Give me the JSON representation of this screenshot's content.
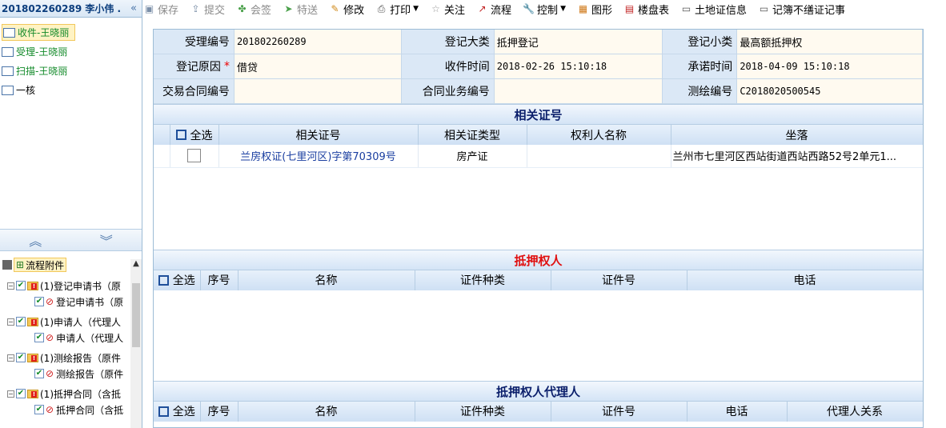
{
  "left": {
    "title": "201802260289 李小伟 ...",
    "collapse_glyph": "«",
    "steps": [
      {
        "label": "收件-王晓丽",
        "style": "active green"
      },
      {
        "label": "受理-王晓丽",
        "style": "green"
      },
      {
        "label": "扫描-王晓丽",
        "style": "green"
      },
      {
        "label": "一核",
        "style": ""
      }
    ],
    "splitter": {
      "up_glyph": "︽",
      "down_glyph": "︾"
    },
    "tree": {
      "root_label": "流程附件",
      "items": [
        {
          "parent": "(1)登记申请书（原",
          "child": "登记申请书（原"
        },
        {
          "parent": "(1)申请人（代理人",
          "child": "申请人（代理人"
        },
        {
          "parent": "(1)测绘报告（原件",
          "child": "测绘报告（原件"
        },
        {
          "parent": "(1)抵押合同（含抵",
          "child": "抵押合同（含抵"
        }
      ]
    }
  },
  "toolbar": {
    "items": [
      {
        "label": "保存",
        "icon": "save-icon",
        "glyph": "▣",
        "color": "#7b8fa8",
        "disabled": true
      },
      {
        "label": "提交",
        "icon": "submit-icon",
        "glyph": "⇪",
        "color": "#7b8fa8",
        "disabled": true
      },
      {
        "label": "会签",
        "icon": "countersign-icon",
        "glyph": "✤",
        "color": "#4aa04a",
        "disabled": true
      },
      {
        "label": "特送",
        "icon": "special-send-icon",
        "glyph": "➤",
        "color": "#4aa04a",
        "disabled": true
      },
      {
        "label": "修改",
        "icon": "edit-icon",
        "glyph": "✎",
        "color": "#d08a1a",
        "disabled": false
      },
      {
        "label": "打印",
        "icon": "print-icon",
        "glyph": "⎙",
        "color": "#555555",
        "disabled": false,
        "dropdown": true
      },
      {
        "label": "关注",
        "icon": "star-icon",
        "glyph": "☆",
        "color": "#999999",
        "disabled": false
      },
      {
        "label": "流程",
        "icon": "flow-chart-icon",
        "glyph": "↗",
        "color": "#c02020",
        "disabled": false
      },
      {
        "label": "控制",
        "icon": "wrench-icon",
        "glyph": "🔧",
        "color": "#555555",
        "disabled": false,
        "dropdown": true
      },
      {
        "label": "图形",
        "icon": "graphic-icon",
        "glyph": "▦",
        "color": "#d07a1a",
        "disabled": false
      },
      {
        "label": "楼盘表",
        "icon": "building-table-icon",
        "glyph": "▤",
        "color": "#c02020",
        "disabled": false
      },
      {
        "label": "土地证信息",
        "icon": "land-cert-icon",
        "glyph": "▭",
        "color": "#555555",
        "disabled": false
      },
      {
        "label": "记簿不缮证记事",
        "icon": "register-note-icon",
        "glyph": "▭",
        "color": "#555555",
        "disabled": false
      }
    ]
  },
  "form": {
    "rows": [
      [
        {
          "label": "受理编号",
          "value": "201802260289",
          "mono": true
        },
        {
          "label": "登记大类",
          "value": "抵押登记",
          "mono": false
        },
        {
          "label": "登记小类",
          "value": "最高额抵押权",
          "mono": false
        }
      ],
      [
        {
          "label": "登记原因",
          "required": "*",
          "value": "借贷",
          "mono": false
        },
        {
          "label": "收件时间",
          "value": "2018-02-26 15:10:18",
          "mono": true
        },
        {
          "label": "承诺时间",
          "value": "2018-04-09 15:10:18",
          "mono": true
        }
      ],
      [
        {
          "label": "交易合同编号",
          "value": "",
          "mono": true
        },
        {
          "label": "合同业务编号",
          "value": "",
          "mono": true
        },
        {
          "label": "测绘编号",
          "value": "C2018020500545",
          "mono": true
        }
      ]
    ]
  },
  "sections": {
    "related_cert": {
      "title": "相关证号",
      "select_all": "全选",
      "columns": [
        "相关证号",
        "相关证类型",
        "权利人名称",
        "坐落"
      ],
      "rows": [
        {
          "cert_no": "兰房权证(七里河区)字第70309号",
          "cert_type": "房产证",
          "owner": "",
          "location": "兰州市七里河区西站街道西站西路52号2单元1..."
        }
      ]
    },
    "mortgagee": {
      "title": "抵押权人",
      "select_all": "全选",
      "columns": [
        "序号",
        "名称",
        "证件种类",
        "证件号",
        "电话"
      ]
    },
    "mortgagee_agent": {
      "title": "抵押权人代理人",
      "select_all": "全选",
      "columns": [
        "序号",
        "名称",
        "证件种类",
        "证件号",
        "电话",
        "代理人关系"
      ]
    }
  }
}
